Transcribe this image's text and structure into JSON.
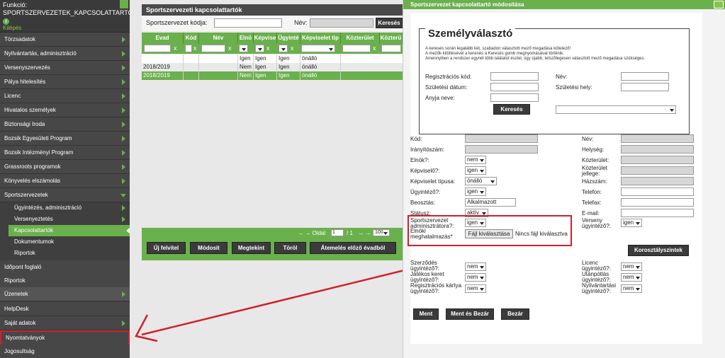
{
  "sidebar": {
    "function_label": "Funkció:",
    "function_value": "SPORTSZERVEZETEK_KAPCSOLATTARTOK",
    "info_icon": "info-icon",
    "logout": "Kilépés",
    "items": [
      {
        "label": "Törzsadatok"
      },
      {
        "label": "Nyilvántartás, adminisztráció"
      },
      {
        "label": "Versenyszervezés"
      },
      {
        "label": "Pálya hitelesítés"
      },
      {
        "label": "Licenc"
      },
      {
        "label": "Hivatalos személyek"
      },
      {
        "label": "Biztonsági Iroda"
      },
      {
        "label": "Bozsik Egyesületi Program"
      },
      {
        "label": "Bozsik Intézményi Program"
      },
      {
        "label": "Grassroots programok"
      },
      {
        "label": "Könyvelés elszámolás"
      },
      {
        "label": "Sportszervezetek"
      }
    ],
    "subitems": [
      {
        "label": "Ügyintézés, adminisztráció"
      },
      {
        "label": "Versenyeztetés"
      },
      {
        "label": "Kapcsolattartók"
      },
      {
        "label": "Dokumentumok"
      },
      {
        "label": "Riportok"
      }
    ],
    "items2": [
      {
        "label": "Időpont foglaló"
      },
      {
        "label": "Riportok"
      },
      {
        "label": "Üzenetek"
      },
      {
        "label": "HelpDesk"
      },
      {
        "label": "Saját adatok"
      },
      {
        "label": "Nyomtatványok"
      },
      {
        "label": "Jogosultság"
      }
    ]
  },
  "list": {
    "title": "Sportszervezeti kapcsolattartók",
    "code_label": "Sportszervezet kódja:",
    "name_label": "Név:",
    "search_button": "Keresés",
    "columns": [
      "Evad",
      "Kód",
      "Név",
      "Elnö",
      "Képvise",
      "Ügyinté",
      "Képviselet tip",
      "Közterület",
      "Közterü"
    ],
    "filter_x": "x",
    "rows": [
      [
        "",
        "",
        "",
        "Igen",
        "Igen",
        "Igen",
        "önálló"
      ],
      [
        "2018/2019",
        "",
        "",
        "Nem",
        "Igen",
        "Igen",
        "önálló"
      ],
      [
        "2018/2019",
        "",
        "",
        "Nem",
        "Igen",
        "Igen",
        "önálló"
      ]
    ],
    "pager_prefix": "→ → Oldal",
    "page_value": "1",
    "pager_of": "/ 1",
    "pager_next": "→ →",
    "page_size": "100",
    "buttons": [
      "Új felvitel",
      "Módosít",
      "Megtekint",
      "Töröl",
      "Átemelés előző évadból"
    ]
  },
  "modal": {
    "title": "Sportszervezet kapcsolattartó módosítása",
    "picker_title": "Személyválasztó",
    "info_lines": [
      "A keresés során legalább két, szabadon választott mező megadása kötelező!",
      "A mezők kitöltésével a keresés a Keresés gomb megnyomásával történik.",
      "Amennyiben a rendszer egynél több találatot észlel, úgy újabb, tetszőlegesen választott mező megadása szükséges."
    ],
    "reg_code": "Regisztrációs kód:",
    "birth_date": "Születési dátum:",
    "mother_name": "Anyja neve:",
    "name": "Név:",
    "birth_place": "Születési hely:",
    "search_button": "Keresés",
    "fields_left": [
      "Kód:",
      "Irányítószám:",
      "Elnök?:",
      "Képviselő?:",
      "Képviselet típusa:",
      "Ügyintéző?:",
      "Beosztás:",
      "Státusz:"
    ],
    "fields_right": [
      "Név:",
      "Helység:",
      "Közterület:",
      "Közterület jellege:",
      "Házszám:",
      "Telefon:",
      "Telefax:",
      "E-mail:"
    ],
    "values": {
      "elnok": "nem",
      "kepviselo": "igen",
      "kepviselet_tipus": "önálló",
      "ugyintezo": "igen",
      "beosztas": "Alkalmazott",
      "statusz": "aktív"
    },
    "sport_admin": "Sportszervezet adminisztrátora?:",
    "sport_admin_value": "igen",
    "elnoki": "Elnöki meghatalmazás*",
    "file_button": "Fájl kiválasztása",
    "file_none": "Nincs fájl kiválasztva",
    "verseny_ugyintezo": "Verseny ügyintéző?:",
    "verseny_value": "igen",
    "korosztaly_button": "Korosztályszintek",
    "bottom_left": [
      "Szerződés ügyintéző?:",
      "Játékos keret ügyintéző?:",
      "Regisztrációs kártya ügyintéző?:"
    ],
    "bottom_right": [
      "Licenc ügyintéző?:",
      "Utánpótlás ügyintéző?:",
      "Nyilvántartási ügyintéző?:"
    ],
    "nem": "nem",
    "footer_buttons": [
      "Ment",
      "Ment és Bezár",
      "Bezár"
    ]
  },
  "colors": {
    "accent": "#6ab04c",
    "dark": "#3f3f3f",
    "highlight": "#d1202a"
  }
}
